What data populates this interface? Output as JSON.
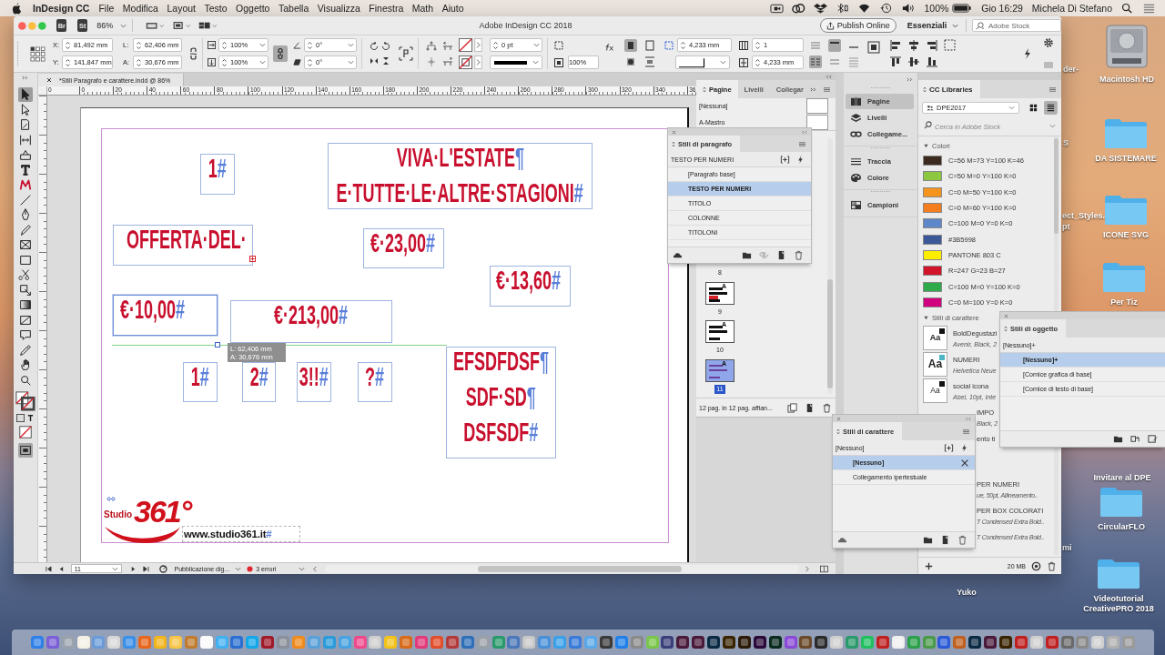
{
  "menu_bar": {
    "app_name": "InDesign CC",
    "menus": [
      "File",
      "Modifica",
      "Layout",
      "Testo",
      "Oggetto",
      "Tabella",
      "Visualizza",
      "Finestra",
      "Math",
      "Aiuto"
    ],
    "battery": "100%",
    "clock": "Gio 16:29",
    "user": "Michela Di Stefano"
  },
  "window": {
    "title": "Adobe InDesign CC 2018",
    "app_buttons": [
      "Br",
      "St"
    ],
    "zoom": "86%",
    "publish_button": "Publish Online",
    "workspace": "Essenziali",
    "stock_search": {
      "placeholder": "Adobe Stock"
    }
  },
  "control_panel": {
    "position": [
      {
        "label": "X:",
        "value": "81,492 mm"
      },
      {
        "label": "Y:",
        "value": "141,847 mm"
      }
    ],
    "size": [
      {
        "label": "L:",
        "value": "62,406 mm"
      },
      {
        "label": "A:",
        "value": "30,676 mm"
      }
    ],
    "scale": [
      "100%",
      "100%"
    ],
    "angles": [
      "0°",
      "0°"
    ],
    "stroke_weight": "0 pt",
    "fitting": "100%",
    "inset": "4,233 mm",
    "columns": "1",
    "gutter": "4,233 mm"
  },
  "document": {
    "tab": "*Stili Paragrafo e carattere.indd @ 86%",
    "ruler_labels": [
      "0",
      "0",
      "20",
      "40",
      "60",
      "80",
      "100",
      "120",
      "140",
      "160",
      "180",
      "200",
      "220",
      "240",
      "260",
      "280",
      "300",
      "320",
      "340",
      "36"
    ],
    "frames": [
      {
        "lines": [
          {
            "text": "1",
            "mark": "#"
          }
        ],
        "selected": false,
        "overset": false
      },
      {
        "lines": [
          {
            "text": "VIVA·L'ESTATE",
            "mark": "¶"
          },
          {
            "text": "E·TUTTE·LE·ALTRE·STAGIONI",
            "mark": "#"
          }
        ],
        "selected": false,
        "overset": false
      },
      {
        "lines": [
          {
            "text": "OFFERTA·DEL·"
          }
        ],
        "selected": false,
        "overset": true
      },
      {
        "lines": [
          {
            "text": "€·23,00",
            "mark": "#"
          }
        ],
        "selected": false,
        "overset": false
      },
      {
        "lines": [
          {
            "text": "€·13,60",
            "mark": "#"
          }
        ],
        "selected": false,
        "overset": false
      },
      {
        "lines": [
          {
            "text": "€·10,00",
            "mark": "#"
          }
        ],
        "selected": true,
        "overset": false
      },
      {
        "lines": [
          {
            "text": "€·213,00",
            "mark": "#"
          }
        ],
        "selected": false,
        "overset": false
      },
      {
        "lines": [
          {
            "text": "1",
            "mark": "#"
          }
        ],
        "selected": false,
        "overset": false
      },
      {
        "lines": [
          {
            "text": "2",
            "mark": "#"
          }
        ],
        "selected": false,
        "overset": false
      },
      {
        "lines": [
          {
            "text": "3!!",
            "mark": "#"
          }
        ],
        "selected": false,
        "overset": false
      },
      {
        "lines": [
          {
            "text": "?",
            "mark": "#"
          }
        ],
        "selected": false,
        "overset": false
      },
      {
        "lines": [
          {
            "text": "EFSDFDSF",
            "mark": "¶"
          },
          {
            "text": "SDF·SD",
            "mark": "¶"
          },
          {
            "text": "DSFSDF",
            "mark": "#"
          }
        ],
        "selected": false,
        "overset": false
      }
    ],
    "tooltip": [
      "L: 62,406 mm",
      "A: 30,676 mm"
    ],
    "logo": {
      "small": "Studio",
      "large": "361°"
    },
    "url_frame": {
      "text": "www.studio361.it",
      "mark": "#"
    }
  },
  "status_bar": {
    "page": "11",
    "preflight_profile": "Pubblicazione dig...",
    "errors": "3 errori"
  },
  "pages_panel": {
    "tabs": [
      {
        "label": "Pagine",
        "selected": true
      },
      {
        "label": "Livelli",
        "selected": false
      },
      {
        "label": "Collegar",
        "selected": false
      }
    ],
    "masters": [
      "[Nessuna]",
      "A-Mastro"
    ],
    "pages": [
      {
        "number": "8",
        "selected": false
      },
      {
        "number": "9",
        "master": "A",
        "selected": false
      },
      {
        "number": "10",
        "master": "A",
        "selected": false
      },
      {
        "number": "11",
        "master": "A",
        "selected": true
      }
    ],
    "summary": "12 pag. in 12 pag. affian..."
  },
  "paragraph_styles": {
    "title": "Stili di paragrafo",
    "current": "TESTO PER NUMERI",
    "styles": [
      {
        "name": "[Paragrafo base]",
        "selected": false
      },
      {
        "name": "TESTO PER NUMERI",
        "selected": true
      },
      {
        "name": "TITOLO",
        "selected": false
      },
      {
        "name": "COLONNE",
        "selected": false
      },
      {
        "name": "TITOLONI",
        "selected": false
      }
    ]
  },
  "panel_dock": {
    "groups": [
      {
        "items": [
          {
            "label": "Pagine",
            "selected": true
          },
          {
            "label": "Livelli",
            "selected": false
          },
          {
            "label": "Collegame...",
            "selected": false
          }
        ]
      },
      {
        "items": [
          {
            "label": "Traccia",
            "selected": false
          },
          {
            "label": "Colore",
            "selected": false
          }
        ]
      },
      {
        "items": [
          {
            "label": "Campioni",
            "selected": false
          }
        ]
      }
    ]
  },
  "cc_libraries": {
    "title": "CC Libraries",
    "library": "DPE2017",
    "list_view": true,
    "search": {
      "placeholder": "Cerca in Adobe Stock"
    },
    "colors_section": {
      "title": "Colori",
      "expanded": true,
      "items": [
        {
          "name": "C=56 M=73 Y=100 K=46",
          "color": "#3d2a1e"
        },
        {
          "name": "C=50 M=0 Y=100 K=0",
          "color": "#8dc63f"
        },
        {
          "name": "C=0 M=50 Y=100 K=0",
          "color": "#f7941d"
        },
        {
          "name": "C=0 M=60 Y=100 K=0",
          "color": "#f47d20"
        },
        {
          "name": "C=100 M=0 Y=0 K=0",
          "color": "#5d87c9"
        },
        {
          "name": "#3B5998",
          "color": "#3b5998"
        },
        {
          "name": "PANTONE 803 C",
          "color": "#ffed00"
        },
        {
          "name": "R=247 G=23 B=27",
          "color": "#d2142a"
        },
        {
          "name": "C=100 M=0 Y=100 K=0",
          "color": "#2eaa4a"
        },
        {
          "name": "C=0 M=100 Y=0 K=0",
          "color": "#d1007e"
        }
      ]
    },
    "styles_section": {
      "title": "Stili di carattere",
      "expanded": true,
      "items": [
        {
          "sample": "Aa",
          "name": "BoldDegustazi",
          "detail": "Avenir, Black, 2",
          "color": "#111111"
        },
        {
          "sample": "Aa",
          "name": "NUMERI",
          "detail": "Helvetica Neue",
          "color": "#4cb6c4"
        },
        {
          "sample": "Aa",
          "name": "social icona",
          "detail": "Abel, 10pt, Inte",
          "color": "#111111"
        },
        {
          "name": "IMPO",
          "detail": "Black, 2"
        },
        {
          "name": "ento ti"
        },
        {
          "name": "PER NUMERI",
          "detail": "ue, 50pt, Allineamento.."
        },
        {
          "name": "PER BOX COLORATI",
          "detail": "T Condensed Extra Bold.."
        },
        {
          "detail": "T Condensed Extra Bold.."
        }
      ]
    },
    "storage": "20 MB"
  },
  "char_styles": {
    "title": "Stili di carattere",
    "current": "[Nessuno]",
    "styles": [
      {
        "name": "[Nessuno]",
        "selected": true
      },
      {
        "name": "Collegamento ipertestuale",
        "selected": false
      }
    ]
  },
  "object_styles": {
    "title": "Stili di oggetto",
    "current": "[Nessuno]+",
    "styles": [
      {
        "name": "[Nessuno]+",
        "selected": true
      },
      {
        "name": "[Cornice grafica di base]",
        "selected": false
      },
      {
        "name": "[Cornice di testo di base]",
        "selected": false
      }
    ]
  },
  "desktop": {
    "icons": [
      {
        "label": "Macintosh HD",
        "kind": "disk"
      },
      {
        "label": "DA SISTEMARE",
        "kind": "folder"
      },
      {
        "label": "ICONE SVG",
        "kind": "folder"
      },
      {
        "label": "Per Tiz",
        "kind": "folder"
      },
      {
        "label": "Invitare al DPE",
        "kind": "label"
      },
      {
        "label": "CircularFLO",
        "kind": "folder"
      },
      {
        "label": "Videotutorial CreativePRO 2018",
        "kind": "folder"
      },
      {
        "label": "Yuko",
        "kind": "label"
      },
      {
        "label": "der-",
        "kind": "label"
      },
      {
        "label": "S",
        "kind": "label"
      },
      {
        "label": "ect_Styles.",
        "kind": "label"
      },
      {
        "label": "pt",
        "kind": "label"
      },
      {
        "label": "mi",
        "kind": "label"
      }
    ]
  }
}
